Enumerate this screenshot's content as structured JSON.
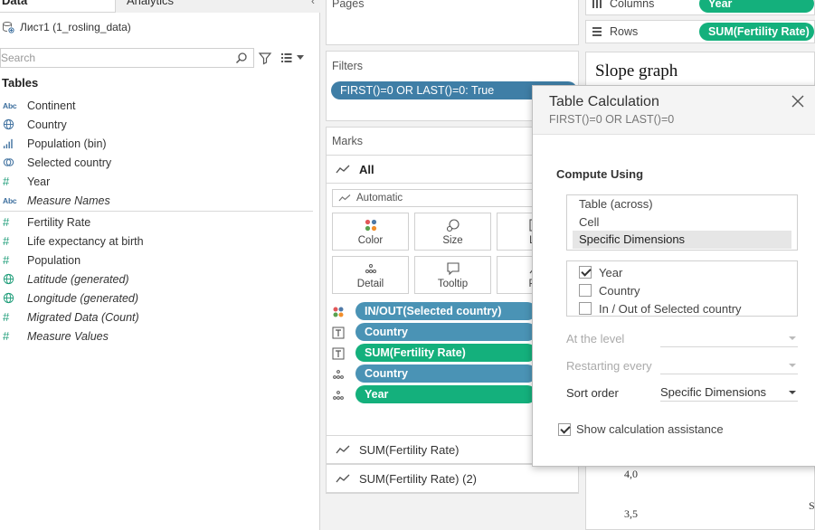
{
  "left_pane": {
    "tab_data": "Data",
    "tab_analytics": "Analytics",
    "datasource": "Лист1 (1_rosling_data)",
    "search_placeholder": "Search",
    "tables_header": "Tables",
    "dimensions": [
      {
        "label": "Continent",
        "icon": "abc",
        "italic": false
      },
      {
        "label": "Country",
        "icon": "globe",
        "italic": false
      },
      {
        "label": "Population (bin)",
        "icon": "bins",
        "italic": false
      },
      {
        "label": "Selected country",
        "icon": "set",
        "italic": false
      },
      {
        "label": "Year",
        "icon": "hash",
        "italic": false
      },
      {
        "label": "Measure Names",
        "icon": "abc",
        "italic": true
      }
    ],
    "measures": [
      {
        "label": "Fertility Rate",
        "icon": "hash",
        "italic": false
      },
      {
        "label": "Life expectancy at birth",
        "icon": "hash",
        "italic": false
      },
      {
        "label": "Population",
        "icon": "hash",
        "italic": false
      },
      {
        "label": "Latitude (generated)",
        "icon": "globe",
        "italic": true
      },
      {
        "label": "Longitude (generated)",
        "icon": "globe",
        "italic": true
      },
      {
        "label": "Migrated Data (Count)",
        "icon": "hash",
        "italic": true
      },
      {
        "label": "Measure Values",
        "icon": "hash",
        "italic": true
      }
    ]
  },
  "pages": {
    "title": "Pages"
  },
  "filters": {
    "title": "Filters",
    "pill": "FIRST()=0 OR LAST()=0: True"
  },
  "marks": {
    "title": "Marks",
    "all_label": "All",
    "mark_type": "Automatic",
    "buttons": {
      "color": "Color",
      "size": "Size",
      "label": "La",
      "detail": "Detail",
      "tooltip": "Tooltip",
      "path": "Pa"
    },
    "pills": [
      {
        "label": "IN/OUT(Selected country)",
        "type": "color",
        "color": "blue"
      },
      {
        "label": "Country",
        "type": "label",
        "color": "blue"
      },
      {
        "label": "SUM(Fertility Rate)",
        "type": "label",
        "color": "green"
      },
      {
        "label": "Country",
        "type": "detail",
        "color": "blue"
      },
      {
        "label": "Year",
        "type": "detail",
        "color": "green"
      }
    ],
    "measure_1": "SUM(Fertility Rate)",
    "measure_2": "SUM(Fertility Rate) (2)"
  },
  "shelves": {
    "columns_label": "Columns",
    "columns_pill": "Year",
    "rows_label": "Rows",
    "rows_pill": "SUM(Fertility Rate)"
  },
  "sheet": {
    "title": "Slope graph",
    "tick_1": "4,0",
    "tick_2": "3,5",
    "partial_label": "S"
  },
  "dialog": {
    "title": "Table Calculation",
    "subtitle": "FIRST()=0 OR LAST()=0",
    "compute_using_label": "Compute Using",
    "compute_options": [
      "Table (across)",
      "Cell",
      "Specific Dimensions"
    ],
    "selected_compute": "Specific Dimensions",
    "dimensions": [
      {
        "label": "Year",
        "checked": true
      },
      {
        "label": "Country",
        "checked": false
      },
      {
        "label": "In / Out of Selected country",
        "checked": false
      }
    ],
    "at_level_label": "At the level",
    "restarting_label": "Restarting every",
    "sort_order_label": "Sort order",
    "sort_order_value": "Specific Dimensions",
    "show_assistance_label": "Show calculation assistance",
    "show_assistance_checked": true
  },
  "colors": {
    "pill_blue": "#4a93b5",
    "pill_green": "#14b07c",
    "filter_blue": "#3f7ea6"
  }
}
